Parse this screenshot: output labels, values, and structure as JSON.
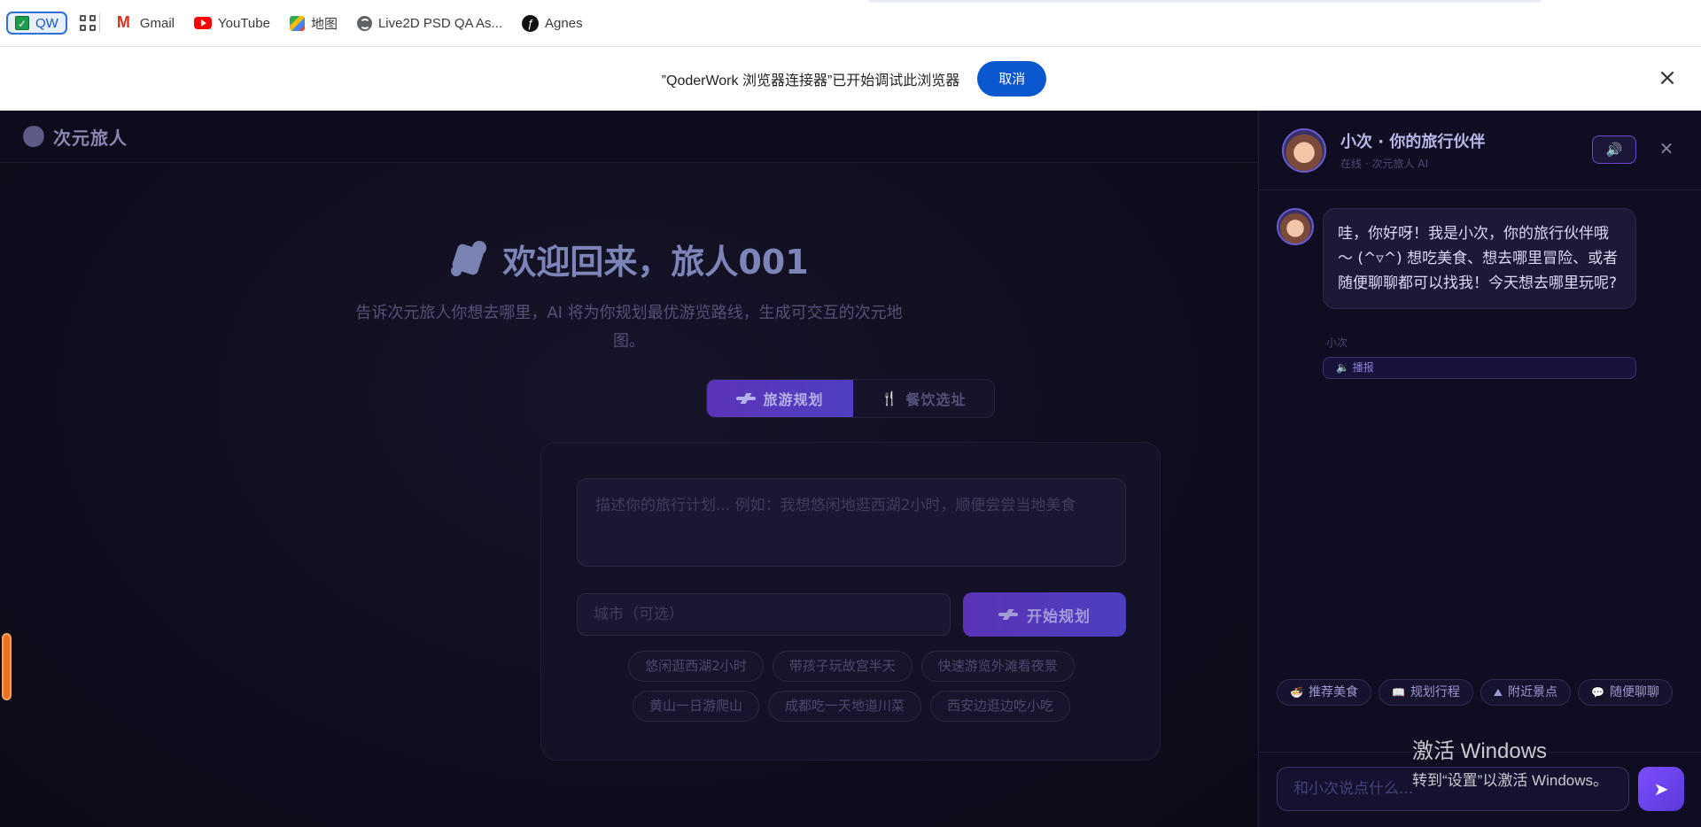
{
  "bookmarks": [
    {
      "label": "QW",
      "icon": "qw-checkbox-icon"
    },
    {
      "label": "Gmail",
      "icon": "gmail-icon"
    },
    {
      "label": "YouTube",
      "icon": "youtube-icon"
    },
    {
      "label": "地图",
      "icon": "maps-icon"
    },
    {
      "label": "Live2D PSD QA As...",
      "icon": "globe-icon"
    },
    {
      "label": "Agnes",
      "icon": "agnes-icon"
    }
  ],
  "notice": {
    "text": "”QoderWork 浏览器连接器”已开始调试此浏览器",
    "cancel": "取消",
    "close": "×"
  },
  "app": {
    "brand": "次元旅人",
    "title": "欢迎回来，旅人001",
    "subtitle": "告诉次元旅人你想去哪里，AI 将为你规划最优游览路线，生成可交互的次元地图。",
    "tabs": [
      "旅游规划",
      "餐饮选址"
    ],
    "active_tab": "旅游规划",
    "description_placeholder": "描述你的旅行计划... 例如：我想悠闲地逛西湖2小时，顺便尝尝当地美食",
    "city_placeholder": "城市（可选）",
    "start_button": "开始规划",
    "suggestions": [
      "悠闲逛西湖2小时",
      "带孩子玩故宫半天",
      "快速游览外滩看夜景",
      "黄山一日游爬山",
      "成都吃一天地道川菜",
      "西安边逛边吃小吃"
    ]
  },
  "chat": {
    "title": "小次 · 你的旅行伙伴",
    "status": "在线 · 次元旅人 AI",
    "speaker": "🔊",
    "close": "×",
    "message": "哇，你好呀！我是小次，你的旅行伙伴哦～ (^▿^) 想吃美食、想去哪里冒险、或者随便聊聊都可以找我！今天想去哪里玩呢?",
    "sender": "小次",
    "broadcast": "播报",
    "quick_actions": [
      {
        "icon": "🍜",
        "label": "推荐美食"
      },
      {
        "icon": "📖",
        "label": "规划行程"
      },
      {
        "icon": "⛰",
        "label": "附近景点"
      },
      {
        "icon": "💬",
        "label": "随便聊聊"
      }
    ],
    "input_placeholder": "和小次说点什么...",
    "send": "➤"
  },
  "watermark": {
    "line1": "激活 Windows",
    "line2": "转到“设置”以激活 Windows。"
  },
  "colors": {
    "accent": "#5b34b8",
    "background": "#0f0d1e",
    "notice_button": "#0b57d0",
    "scroll_handle": "#e87324"
  }
}
